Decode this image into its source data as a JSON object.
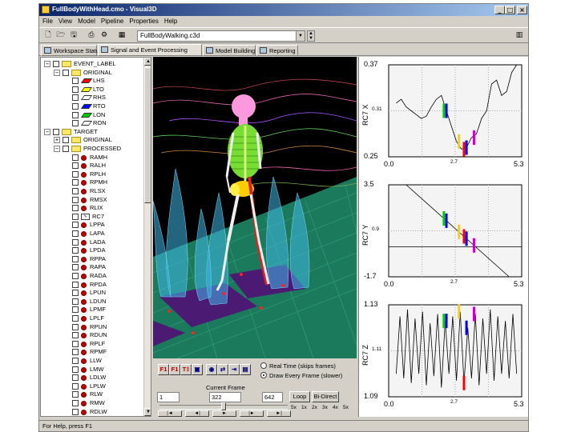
{
  "window": {
    "title": "FullBodyWithHead.cmo - Visual3D"
  },
  "menu": [
    "File",
    "View",
    "Model",
    "Pipeline",
    "Properties",
    "Help"
  ],
  "toolbar": {
    "file_value": "FullBodyWalking.c3d"
  },
  "tabs": [
    "Workspace Status",
    "Signal and Event Processing",
    "Model Building",
    "Reporting"
  ],
  "tree": {
    "event_root": "EVENT_LABEL",
    "event_original": "ORIGINAL",
    "events": [
      {
        "label": "LHS",
        "color": "#ff0000"
      },
      {
        "label": "LTO",
        "color": "#ffff00"
      },
      {
        "label": "RHS",
        "color": "#ffffff"
      },
      {
        "label": "RTO",
        "color": "#0000ff"
      },
      {
        "label": "LON",
        "color": "#00cc00"
      },
      {
        "label": "RON",
        "color": "#ffffff"
      }
    ],
    "target_root": "TARGET",
    "target_original": "ORIGINAL",
    "target_processed": "PROCESSED",
    "processed": [
      "RAMH",
      "RALH",
      "RPLH",
      "RPMH",
      "RLSX",
      "RMSX",
      "RLIX",
      "RC7",
      "LPPA",
      "LAPA",
      "LADA",
      "LPDA",
      "RPPA",
      "RAPA",
      "RADA",
      "RPDA",
      "LPUN",
      "LDUN",
      "LPMF",
      "LPLF",
      "RPUN",
      "RDUN",
      "RPLF",
      "RPMF",
      "LLW",
      "LMW",
      "LDLW",
      "LPLW",
      "RLW",
      "RMW",
      "RDLW"
    ]
  },
  "controls": {
    "f_buttons": [
      "F1",
      "F1",
      "T‡"
    ],
    "radio_realtime": "Real Time (skips frames)",
    "radio_every": "Draw Every Frame (slower)",
    "current_frame_label": "Current Frame",
    "frame_start": "1",
    "frame_current": "322",
    "frame_end": "642",
    "current_frame_fraction": 0.5,
    "loop": "Loop",
    "bidirect": "Bi-Direct",
    "speeds": [
      "5x",
      "1x",
      "2x",
      "3x",
      "4x",
      "5x"
    ],
    "transport": [
      "|◄",
      "◄|",
      "►",
      "|►",
      "►|"
    ]
  },
  "chart_data": [
    {
      "type": "line",
      "ylabel": "RC7 X",
      "yticks": [
        "0.37",
        "0.31",
        "0.25"
      ],
      "ylim": [
        0.25,
        0.37
      ],
      "xticks": [
        "0.0",
        "2.7",
        "5.3"
      ],
      "xlim": [
        0,
        5.3
      ],
      "x": [
        0.3,
        0.5,
        0.7,
        0.9,
        1.1,
        1.3,
        1.5,
        1.7,
        1.9,
        2.1,
        2.3,
        2.5,
        2.7,
        2.9,
        3.1,
        3.3,
        3.5,
        3.7,
        3.9,
        4.1,
        4.3,
        4.5,
        4.7,
        4.9,
        5.1,
        5.3
      ],
      "y": [
        0.32,
        0.325,
        0.315,
        0.31,
        0.305,
        0.3,
        0.303,
        0.315,
        0.325,
        0.33,
        0.31,
        0.29,
        0.27,
        0.26,
        0.262,
        0.275,
        0.28,
        0.3,
        0.31,
        0.345,
        0.35,
        0.33,
        0.335,
        0.36,
        0.37,
        0.37
      ],
      "events": [
        {
          "x": 2.2,
          "color": "#00cc00"
        },
        {
          "x": 2.3,
          "color": "#0000ff"
        },
        {
          "x": 2.8,
          "color": "#ffcc00"
        },
        {
          "x": 3.0,
          "color": "#ff0000"
        },
        {
          "x": 3.1,
          "color": "#0000ff"
        },
        {
          "x": 3.4,
          "color": "#cc00cc"
        }
      ]
    },
    {
      "type": "line",
      "ylabel": "RC7 Y",
      "yticks": [
        "3.5",
        "0.9",
        "-1.7"
      ],
      "ylim": [
        -1.7,
        3.5
      ],
      "xticks": [
        "0.0",
        "2.7",
        "5.3"
      ],
      "xlim": [
        0,
        5.3
      ],
      "x": [
        0.7,
        4.8
      ],
      "y": [
        3.5,
        -1.7
      ],
      "hline": 0.0,
      "events": [
        {
          "x": 2.2,
          "color": "#00cc00"
        },
        {
          "x": 2.3,
          "color": "#0000ff"
        },
        {
          "x": 2.8,
          "color": "#ffcc00"
        },
        {
          "x": 3.0,
          "color": "#ff0000"
        },
        {
          "x": 3.1,
          "color": "#0000ff"
        },
        {
          "x": 3.4,
          "color": "#cc00cc"
        }
      ]
    },
    {
      "type": "line",
      "ylabel": "RC7 Z",
      "yticks": [
        "1.13",
        "1.11",
        "1.09"
      ],
      "ylim": [
        1.09,
        1.13
      ],
      "xticks": [
        "0.0",
        "2.7",
        "5.3"
      ],
      "xlim": [
        0,
        5.3
      ],
      "x": [
        0.3,
        0.45,
        0.6,
        0.75,
        0.9,
        1.05,
        1.2,
        1.35,
        1.5,
        1.65,
        1.8,
        1.95,
        2.1,
        2.25,
        2.4,
        2.55,
        2.7,
        2.85,
        3.0,
        3.15,
        3.3,
        3.45,
        3.6,
        3.75,
        3.9,
        4.05,
        4.2,
        4.35,
        4.5,
        4.65,
        4.8,
        4.95,
        5.1
      ],
      "y": [
        1.1,
        1.125,
        1.098,
        1.128,
        1.096,
        1.124,
        1.1,
        1.127,
        1.095,
        1.122,
        1.099,
        1.126,
        1.094,
        1.123,
        1.1,
        1.125,
        1.097,
        1.127,
        1.096,
        1.12,
        1.098,
        1.126,
        1.095,
        1.124,
        1.1,
        1.128,
        1.097,
        1.125,
        1.1,
        1.123,
        1.098,
        1.126,
        1.1
      ],
      "events": [
        {
          "x": 2.2,
          "color": "#00cc00"
        },
        {
          "x": 2.3,
          "color": "#0000ff"
        },
        {
          "x": 2.8,
          "color": "#ffcc00"
        },
        {
          "x": 3.0,
          "color": "#ff0000"
        },
        {
          "x": 3.1,
          "color": "#0000ff"
        },
        {
          "x": 3.4,
          "color": "#cc00cc"
        }
      ]
    }
  ],
  "status": "For Help, press F1"
}
